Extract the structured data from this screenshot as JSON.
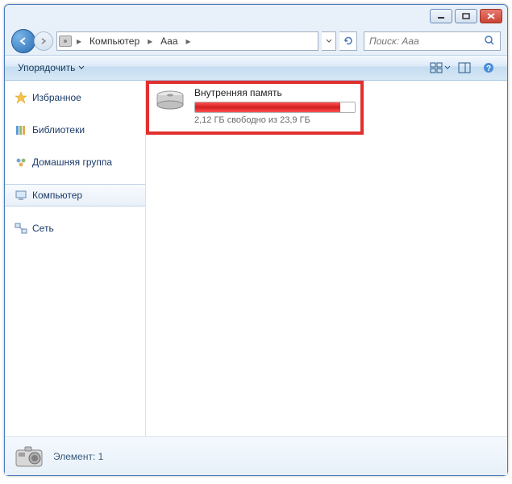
{
  "breadcrumb": {
    "seg1": "Компьютер",
    "seg2": "Aaa"
  },
  "search": {
    "placeholder": "Поиск: Aaa"
  },
  "toolbar": {
    "organize": "Упорядочить"
  },
  "sidebar": {
    "favorites": "Избранное",
    "libraries": "Библиотеки",
    "homegroup": "Домашняя группа",
    "computer": "Компьютер",
    "network": "Сеть"
  },
  "drive": {
    "name": "Внутренняя память",
    "stat": "2,12 ГБ свободно из 23,9 ГБ",
    "fill_pct": 91
  },
  "status": {
    "text": "Элемент: 1"
  }
}
